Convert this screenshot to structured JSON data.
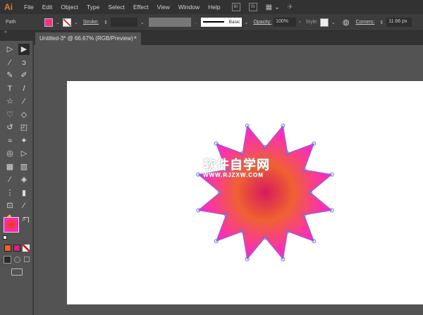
{
  "app": {
    "logo": "Ai"
  },
  "menu": [
    "File",
    "Edit",
    "Object",
    "Type",
    "Select",
    "Effect",
    "View",
    "Window",
    "Help"
  ],
  "app_buttons": [
    "Br",
    "St"
  ],
  "control": {
    "selection": "Path",
    "stroke_label": "Stroke:",
    "brush": "Basic",
    "opacity_label": "Opacity:",
    "opacity": "100%",
    "style_label": "Style:",
    "corners_label": "Corners:",
    "corners": "11.66 px"
  },
  "tab": {
    "title": "Untitled-3* @ 66.67% (RGB/Preview)",
    "close": "×"
  },
  "tools": [
    {
      "name": "direct-selection",
      "g": "▷"
    },
    {
      "name": "selection",
      "g": "▶"
    },
    {
      "name": "magic-wand",
      "g": "⁄"
    },
    {
      "name": "lasso",
      "g": "ↄ"
    },
    {
      "name": "pen",
      "g": "✎"
    },
    {
      "name": "curvature",
      "g": "✐"
    },
    {
      "name": "type",
      "g": "T"
    },
    {
      "name": "line",
      "g": "/"
    },
    {
      "name": "star",
      "g": "☆"
    },
    {
      "name": "paintbrush",
      "g": "∕"
    },
    {
      "name": "shaper",
      "g": "♡"
    },
    {
      "name": "eraser",
      "g": "◇"
    },
    {
      "name": "rotate",
      "g": "↺"
    },
    {
      "name": "scale",
      "g": "◰"
    },
    {
      "name": "warp",
      "g": "≈"
    },
    {
      "name": "puppet-warp",
      "g": "✦"
    },
    {
      "name": "free-transform",
      "g": "◎"
    },
    {
      "name": "shape-builder",
      "g": "▷"
    },
    {
      "name": "mesh",
      "g": "▦"
    },
    {
      "name": "gradient",
      "g": "▥"
    },
    {
      "name": "eyedropper",
      "g": "⁄"
    },
    {
      "name": "blend",
      "g": "◈"
    },
    {
      "name": "symbol-sprayer",
      "g": "⋮"
    },
    {
      "name": "column-graph",
      "g": "▮"
    },
    {
      "name": "artboard",
      "g": "⊡"
    },
    {
      "name": "slice",
      "g": "⁄"
    },
    {
      "name": "hand",
      "g": "✋"
    },
    {
      "name": "zoom",
      "g": "⌕"
    }
  ],
  "colors": {
    "fill": "#ff22cc",
    "center": "#e0205a",
    "mid": "#f05a28",
    "stroke_none": "#cc2222",
    "accent": "#d7813a"
  },
  "watermark": {
    "cn": "软件自学网",
    "url": "WWW.RJZXW.COM"
  }
}
